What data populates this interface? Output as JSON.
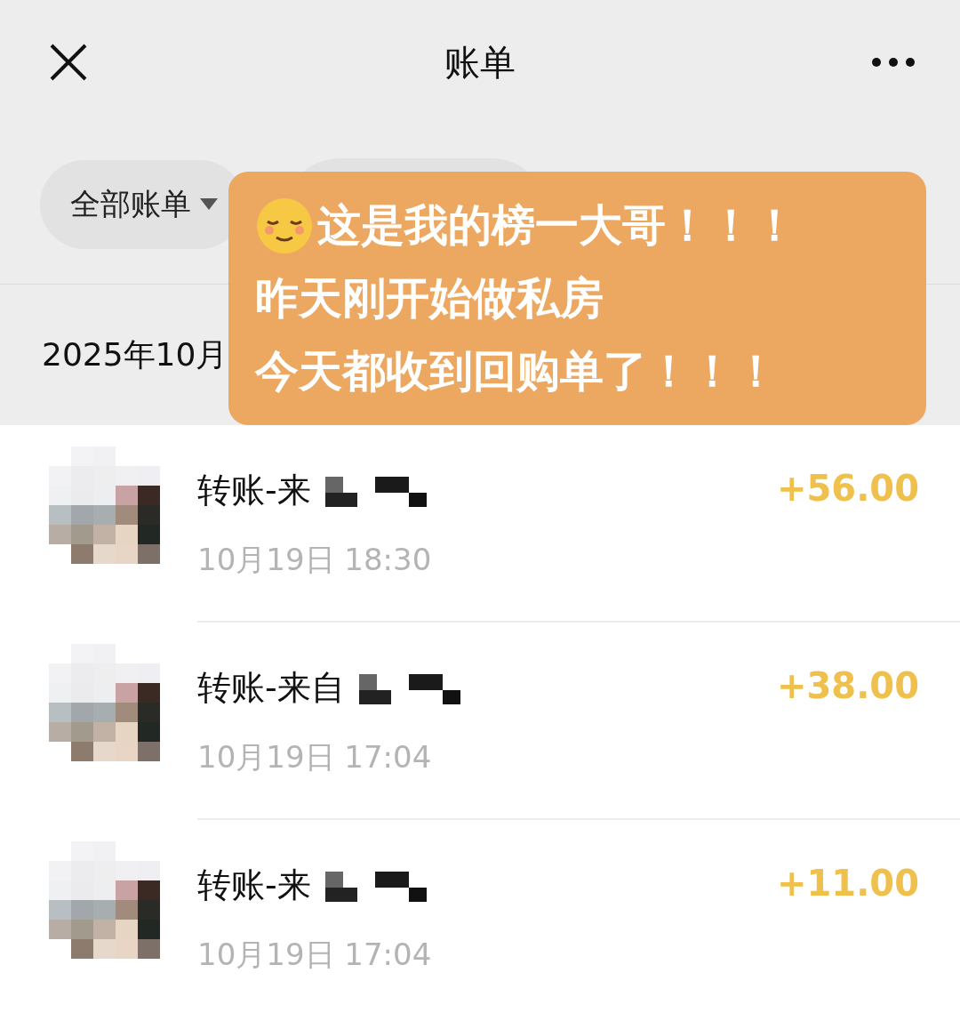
{
  "header": {
    "title": "账单"
  },
  "filter": {
    "label": "全部账单"
  },
  "month": {
    "label": "2025年10月"
  },
  "overlay": {
    "lines": [
      "这是我的榜一大哥！！！",
      "昨天刚开始做私房",
      "今天都收到回购单了！！！"
    ]
  },
  "transactions": [
    {
      "title": "转账-来",
      "time": "10月19日 18:30",
      "amount": "+56.00"
    },
    {
      "title": "转账-来自",
      "time": "10月19日 17:04",
      "amount": "+38.00"
    },
    {
      "title": "转账-来",
      "time": "10月19日 17:04",
      "amount": "+11.00"
    }
  ]
}
